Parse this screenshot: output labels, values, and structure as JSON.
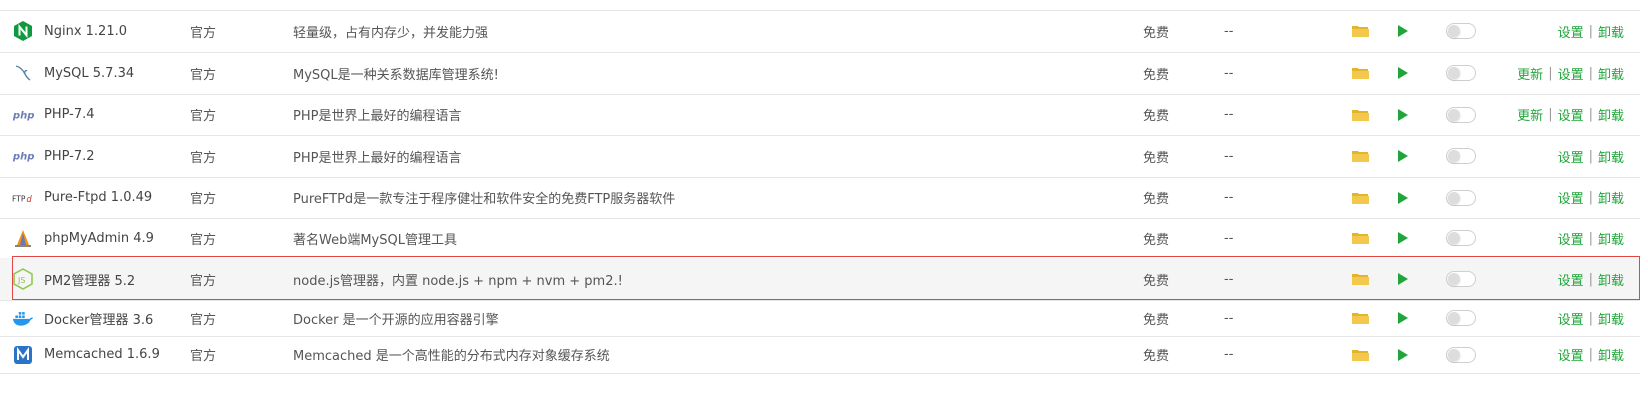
{
  "plugins": [
    {
      "name": "Nginx 1.21.0",
      "icon": "nginx-icon",
      "type": "官方",
      "desc": "轻量级，占有内存少，并发能力强",
      "price": "免费",
      "expire": "--",
      "ops": [
        "设置",
        "卸载"
      ]
    },
    {
      "name": "MySQL 5.7.34",
      "icon": "mysql-dolphin-icon",
      "type": "官方",
      "desc": "MySQL是一种关系数据库管理系统!",
      "price": "免费",
      "expire": "--",
      "ops": [
        "更新",
        "设置",
        "卸载"
      ]
    },
    {
      "name": "PHP-7.4",
      "icon": "php-icon",
      "type": "官方",
      "desc": "PHP是世界上最好的编程语言",
      "price": "免费",
      "expire": "--",
      "ops": [
        "更新",
        "设置",
        "卸载"
      ]
    },
    {
      "name": "PHP-7.2",
      "icon": "php-icon",
      "type": "官方",
      "desc": "PHP是世界上最好的编程语言",
      "price": "免费",
      "expire": "--",
      "ops": [
        "设置",
        "卸载"
      ]
    },
    {
      "name": "Pure-Ftpd 1.0.49",
      "icon": "ftpd-icon",
      "type": "官方",
      "desc": "PureFTPd是一款专注于程序健壮和软件安全的免费FTP服务器软件",
      "price": "免费",
      "expire": "--",
      "ops": [
        "设置",
        "卸载"
      ]
    },
    {
      "name": "phpMyAdmin 4.9",
      "icon": "phpmyadmin-icon",
      "type": "官方",
      "desc": "著名Web端MySQL管理工具",
      "price": "免费",
      "expire": "--",
      "ops": [
        "设置",
        "卸载"
      ]
    },
    {
      "name": "PM2管理器 5.2",
      "icon": "nodejs-icon",
      "type": "官方",
      "desc": "node.js管理器，内置 node.js + npm + nvm + pm2.!",
      "price": "免费",
      "expire": "--",
      "ops": [
        "设置",
        "卸载"
      ]
    },
    {
      "name": "Docker管理器 3.6",
      "icon": "docker-icon",
      "type": "官方",
      "desc": "Docker 是一个开源的应用容器引擎",
      "price": "免费",
      "expire": "--",
      "ops": [
        "设置",
        "卸载"
      ]
    },
    {
      "name": "Memcached 1.6.9",
      "icon": "memcached-icon",
      "type": "官方",
      "desc": "Memcached 是一个高性能的分布式内存对象缓存系统",
      "price": "免费",
      "expire": "--",
      "ops": [
        "设置",
        "卸载"
      ]
    }
  ],
  "colors": {
    "accent": "#20a53a",
    "folder": "#f0c040",
    "highlight": "#e34545"
  }
}
